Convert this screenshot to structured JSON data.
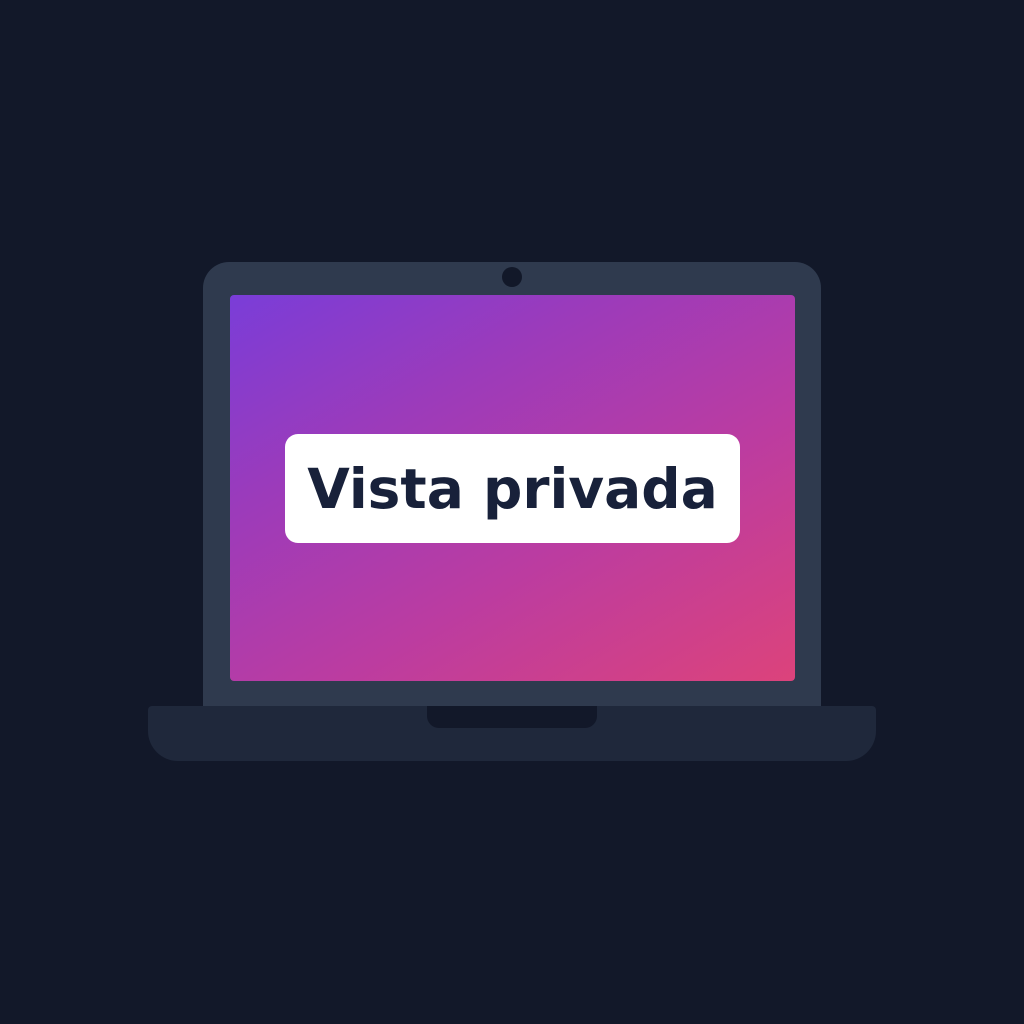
{
  "screen": {
    "label": "Vista privada"
  },
  "colors": {
    "background": "#121829",
    "lid": "#2f3a4e",
    "base": "#1f283b",
    "gradient_start": "#7a3dd8",
    "gradient_end": "#dc437b",
    "label_box": "#ffffff",
    "label_text": "#18213a"
  },
  "icons": {
    "camera": "webcam-icon"
  }
}
